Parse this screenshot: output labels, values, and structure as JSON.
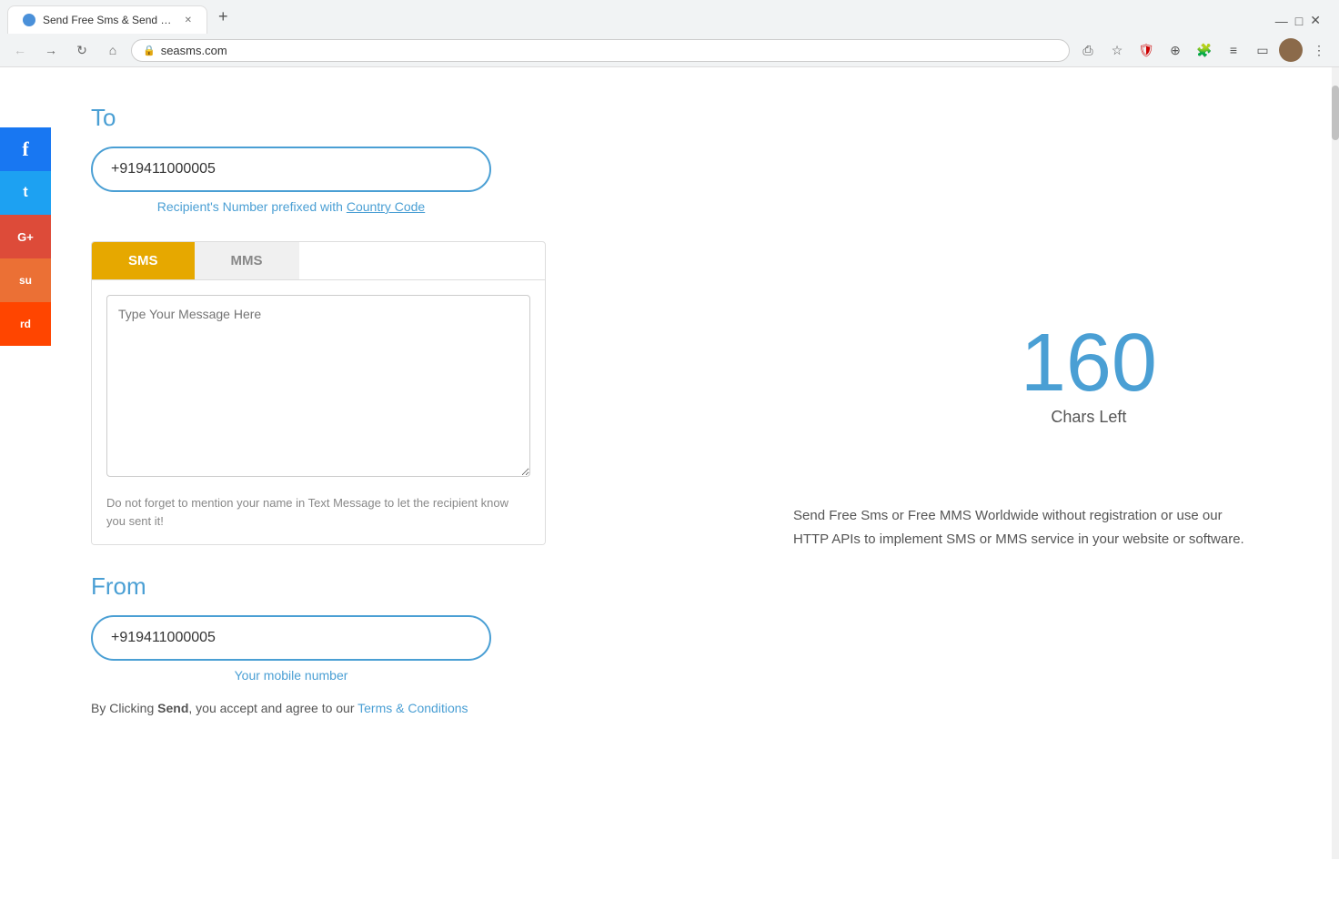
{
  "browser": {
    "tab": {
      "title": "Send Free Sms & Send Free MMS",
      "favicon": "🚀"
    },
    "new_tab_label": "+",
    "url": "seasms.com",
    "window_controls": [
      "▾",
      "—",
      "□",
      "✕"
    ]
  },
  "toolbar": {
    "back_label": "‹",
    "forward_label": "›",
    "refresh_label": "↻",
    "home_label": "⌂",
    "lock_label": "🔒"
  },
  "social": {
    "buttons": [
      {
        "label": "f",
        "color": "#1877f2",
        "name": "facebook"
      },
      {
        "label": "t",
        "color": "#1da1f2",
        "name": "twitter"
      },
      {
        "label": "G+",
        "color": "#dd4b39",
        "name": "google-plus"
      },
      {
        "label": "su",
        "color": "#eb7035",
        "name": "stumbleupon"
      },
      {
        "label": "rd",
        "color": "#ff4500",
        "name": "reddit"
      }
    ]
  },
  "form": {
    "to_label": "To",
    "to_value": "+919411000005",
    "to_placeholder": "+919411000005",
    "recipient_hint": "Recipient's Number prefixed with ",
    "country_code_link": "Country Code",
    "tab_sms": "SMS",
    "tab_mms": "MMS",
    "message_placeholder": "Type Your Message Here",
    "message_hint": "Do not forget to mention your name in Text Message to let the recipient know you sent it!",
    "from_label": "From",
    "from_value": "+919411000005",
    "from_placeholder": "+919411000005",
    "from_hint": "Your mobile number",
    "terms_prefix": "By Clicking ",
    "terms_send": "Send",
    "terms_middle": ", you accept and agree to our ",
    "terms_link": "Terms & Conditions"
  },
  "counter": {
    "chars_left": "160",
    "chars_label": "Chars Left"
  },
  "promo": {
    "text": "Send Free Sms or Free MMS Worldwide without registration or use our HTTP APIs to implement SMS or MMS service in your website or software."
  }
}
